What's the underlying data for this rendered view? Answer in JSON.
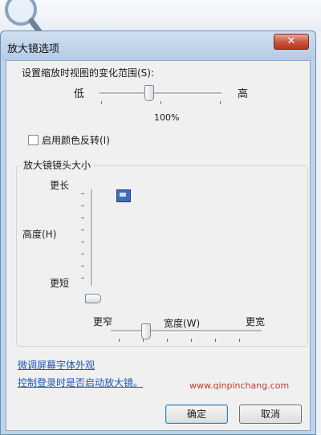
{
  "window": {
    "title": "放大镜选项",
    "close_glyph": "✕"
  },
  "zoom": {
    "label": "设置缩放时视图的变化范围(S):",
    "low": "低",
    "high": "高",
    "value": "100%"
  },
  "invert": {
    "label": "启用颜色反转(I)",
    "checked": false
  },
  "lens": {
    "group_title": "放大镜镜头大小",
    "taller": "更长",
    "height_label": "高度(H)",
    "shorter": "更短",
    "narrower": "更窄",
    "width_label": "宽度(W)",
    "wider": "更宽"
  },
  "links": {
    "fonts": "微调屏幕字体外观",
    "startup": "控制登录时是否启动放大镜。"
  },
  "buttons": {
    "ok": "确定",
    "cancel": "取消"
  },
  "watermark": "www.qinpinchang.com",
  "colors": {
    "titlebar": "#bcd3ea",
    "link": "#1b5ab0",
    "close_button": "#c9513a"
  }
}
